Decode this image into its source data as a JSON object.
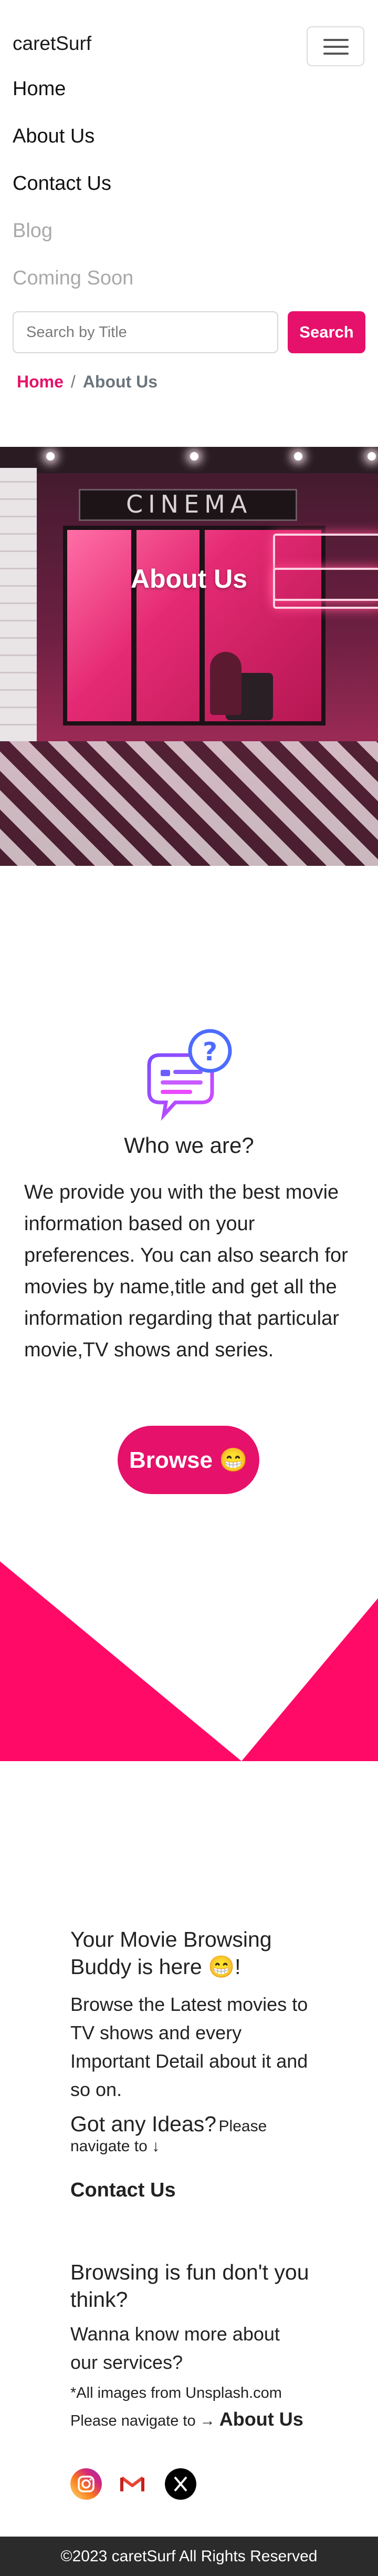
{
  "navbar": {
    "brand": "caretSurf",
    "links": [
      {
        "label": "Home"
      },
      {
        "label": "About Us"
      },
      {
        "label": "Contact Us"
      },
      {
        "label": "Blog"
      },
      {
        "label": "Coming Soon"
      }
    ],
    "search_placeholder": "Search by Title",
    "search_button": "Search"
  },
  "breadcrumb": {
    "home": "Home",
    "separator": "/",
    "current": "About Us"
  },
  "hero": {
    "title": "About Us",
    "sign_text": "CINEMA"
  },
  "who": {
    "title": "Who we are?",
    "body": "We provide you with the best movie information based on your preferences. You can also search for movies by name,title and get all the information regarding that particular movie,TV shows and series.",
    "button": "Browse 😁"
  },
  "buddy": {
    "title": "Your Movie Browsing Buddy is here 😁!",
    "body": "Browse the Latest movies to TV shows and every Important Detail about it and so on.",
    "ideas_heading": "Got any Ideas?",
    "ideas_hint": "Please navigate to ↓",
    "contact_link": "Contact Us"
  },
  "fun": {
    "title": "Browsing is fun don't you think?",
    "body": "Wanna know more about our services?",
    "credit": "*All images from Unsplash.com",
    "navigate": "Please navigate to →",
    "about_link": "About Us"
  },
  "socials": [
    "instagram-icon",
    "gmail-icon",
    "x-icon"
  ],
  "footer": {
    "text": "©2023 caretSurf All Rights Reserved"
  },
  "colors": {
    "accent": "#e6116a",
    "footer_bg": "#2b2b2b"
  }
}
